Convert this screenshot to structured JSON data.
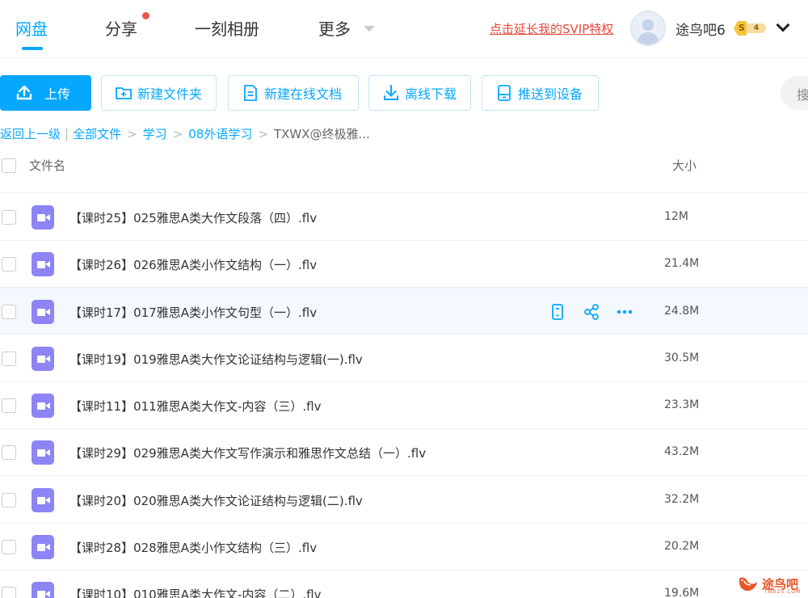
{
  "nav": {
    "tabs": [
      {
        "label": "网盘",
        "active": true
      },
      {
        "label": "分享",
        "has_dot": true
      },
      {
        "label": "一刻相册"
      },
      {
        "label": "更多"
      }
    ],
    "svip_link": "点击延长我的SVIP特权",
    "username": "途鸟吧6",
    "badge_level": "S",
    "badge_number": "4"
  },
  "toolbar": {
    "upload": "上传",
    "new_folder": "新建文件夹",
    "new_doc": "新建在线文档",
    "offline_download": "离线下载",
    "push_device": "推送到设备",
    "search_placeholder": "搜"
  },
  "breadcrumb": {
    "back": "返回上一级",
    "items": [
      "全部文件",
      "学习",
      "08外语学习"
    ],
    "current": "TXWX@终极雅..."
  },
  "list": {
    "col_name": "文件名",
    "col_size": "大小",
    "files": [
      {
        "name": "【课时25】025雅思A类大作文段落（四）.flv",
        "size": "12M"
      },
      {
        "name": "【课时26】026雅思A类小作文结构（一）.flv",
        "size": "21.4M"
      },
      {
        "name": "【课时17】017雅思A类小作文句型（一）.flv",
        "size": "24.8M",
        "hovered": true
      },
      {
        "name": "【课时19】019雅思A类大作文论证结构与逻辑(一).flv",
        "size": "30.5M"
      },
      {
        "name": "【课时11】011雅思A类大作文-内容（三）.flv",
        "size": "23.3M"
      },
      {
        "name": "【课时29】029雅思A类大作文写作演示和雅思作文总结（一）.flv",
        "size": "43.2M"
      },
      {
        "name": "【课时20】020雅思A类大作文论证结构与逻辑(二).flv",
        "size": "32.2M"
      },
      {
        "name": "【课时28】028雅思A类小作文结构（三）.flv",
        "size": "20.2M"
      },
      {
        "name": "【课时10】010雅思A类大作文-内容（二）.flv",
        "size": "19.6M"
      }
    ]
  },
  "watermark": {
    "text": "途鸟吧",
    "sub": "TNBZS.COM"
  },
  "colors": {
    "accent": "#06a7ff",
    "svip": "#e64a3b",
    "video_icon": "#8d84f5",
    "hover_row": "#f3f9fe"
  }
}
